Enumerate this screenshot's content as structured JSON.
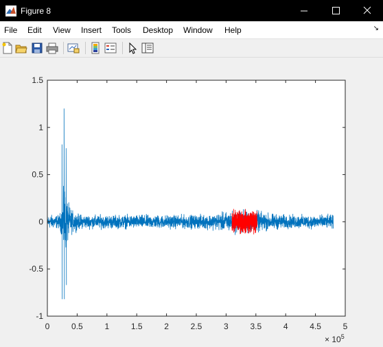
{
  "window": {
    "title": "Figure 8"
  },
  "menus": [
    "File",
    "Edit",
    "View",
    "Insert",
    "Tools",
    "Desktop",
    "Window",
    "Help"
  ],
  "toolbar": [
    "new-figure",
    "open-file",
    "save",
    "print",
    "link-plot",
    "insert-colorbar",
    "insert-legend",
    "edit-plot",
    "property-inspector"
  ],
  "colors": {
    "series": "#0072bd",
    "highlight": "#ff0000",
    "axes_bg": "#ffffff",
    "figure_bg": "#f0f0f0"
  },
  "chart_data": {
    "type": "line",
    "x_ticks": [
      "0",
      "0.5",
      "1",
      "1.5",
      "2",
      "2.5",
      "3",
      "3.5",
      "4",
      "4.5",
      "5"
    ],
    "y_ticks": [
      "1.5",
      "1",
      "0.5",
      "0",
      "-0.5",
      "-1"
    ],
    "x_multiplier": {
      "base": "× 10",
      "exp": "5"
    },
    "xlim": [
      0,
      500000
    ],
    "ylim": [
      -1,
      1.5
    ],
    "series": [
      {
        "x_range": [
          0,
          480000
        ],
        "baseline_amplitude": 0.1,
        "peak_max": 1.2,
        "peak_min": -0.82,
        "peak_at": 28000,
        "color": "#0072bd"
      },
      {
        "x_range": [
          310000,
          352000
        ],
        "amplitude": 0.15,
        "color": "#ff0000"
      }
    ]
  }
}
